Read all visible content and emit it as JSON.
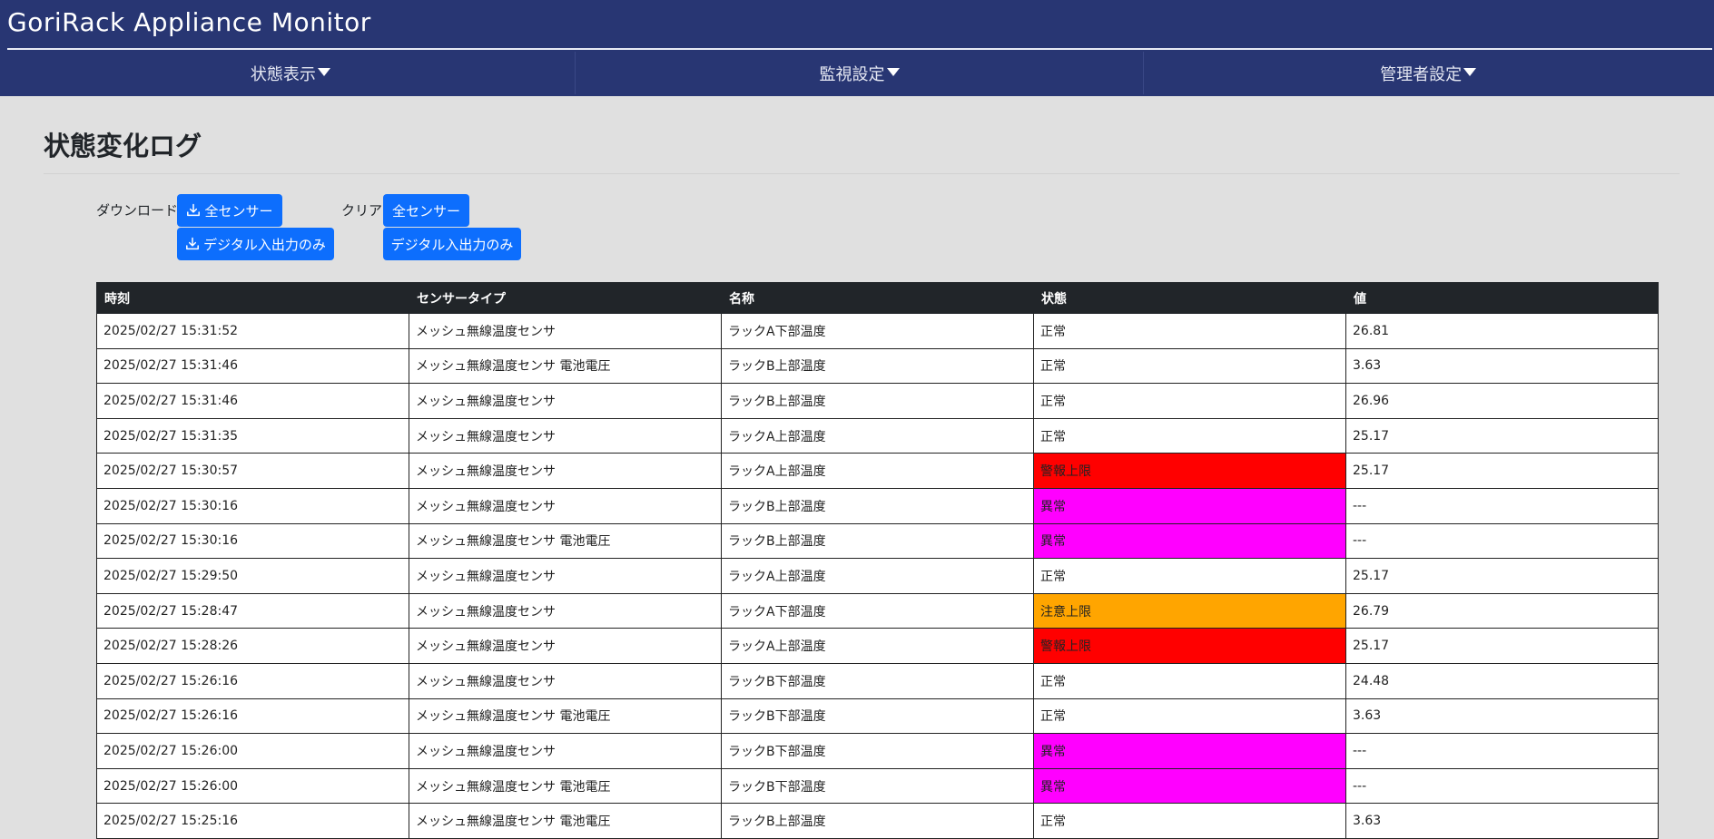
{
  "header": {
    "app_title": "GoriRack Appliance Monitor",
    "nav": [
      {
        "label": "状態表示"
      },
      {
        "label": "監視設定"
      },
      {
        "label": "管理者設定"
      }
    ]
  },
  "page": {
    "title": "状態変化ログ"
  },
  "actions": {
    "download_label": "ダウンロード",
    "clear_label": "クリア",
    "download_all": "全センサー",
    "download_digital": "デジタル入出力のみ",
    "clear_all": "全センサー",
    "clear_digital": "デジタル入出力のみ"
  },
  "table": {
    "columns": [
      "時刻",
      "センサータイプ",
      "名称",
      "状態",
      "値"
    ],
    "rows": [
      {
        "time": "2025/02/27 15:31:52",
        "type": "メッシュ無線温度センサ",
        "name": "ラックA下部温度",
        "status": "正常",
        "value": "26.81",
        "status_class": "normal"
      },
      {
        "time": "2025/02/27 15:31:46",
        "type": "メッシュ無線温度センサ 電池電圧",
        "name": "ラックB上部温度",
        "status": "正常",
        "value": "3.63",
        "status_class": "normal"
      },
      {
        "time": "2025/02/27 15:31:46",
        "type": "メッシュ無線温度センサ",
        "name": "ラックB上部温度",
        "status": "正常",
        "value": "26.96",
        "status_class": "normal"
      },
      {
        "time": "2025/02/27 15:31:35",
        "type": "メッシュ無線温度センサ",
        "name": "ラックA上部温度",
        "status": "正常",
        "value": "25.17",
        "status_class": "normal"
      },
      {
        "time": "2025/02/27 15:30:57",
        "type": "メッシュ無線温度センサ",
        "name": "ラックA上部温度",
        "status": "警報上限",
        "value": "25.17",
        "status_class": "alarm"
      },
      {
        "time": "2025/02/27 15:30:16",
        "type": "メッシュ無線温度センサ",
        "name": "ラックB上部温度",
        "status": "異常",
        "value": "---",
        "status_class": "error"
      },
      {
        "time": "2025/02/27 15:30:16",
        "type": "メッシュ無線温度センサ 電池電圧",
        "name": "ラックB上部温度",
        "status": "異常",
        "value": "---",
        "status_class": "error"
      },
      {
        "time": "2025/02/27 15:29:50",
        "type": "メッシュ無線温度センサ",
        "name": "ラックA上部温度",
        "status": "正常",
        "value": "25.17",
        "status_class": "normal"
      },
      {
        "time": "2025/02/27 15:28:47",
        "type": "メッシュ無線温度センサ",
        "name": "ラックA下部温度",
        "status": "注意上限",
        "value": "26.79",
        "status_class": "warn"
      },
      {
        "time": "2025/02/27 15:28:26",
        "type": "メッシュ無線温度センサ",
        "name": "ラックA上部温度",
        "status": "警報上限",
        "value": "25.17",
        "status_class": "alarm"
      },
      {
        "time": "2025/02/27 15:26:16",
        "type": "メッシュ無線温度センサ",
        "name": "ラックB下部温度",
        "status": "正常",
        "value": "24.48",
        "status_class": "normal"
      },
      {
        "time": "2025/02/27 15:26:16",
        "type": "メッシュ無線温度センサ 電池電圧",
        "name": "ラックB下部温度",
        "status": "正常",
        "value": "3.63",
        "status_class": "normal"
      },
      {
        "time": "2025/02/27 15:26:00",
        "type": "メッシュ無線温度センサ",
        "name": "ラックB下部温度",
        "status": "異常",
        "value": "---",
        "status_class": "error"
      },
      {
        "time": "2025/02/27 15:26:00",
        "type": "メッシュ無線温度センサ 電池電圧",
        "name": "ラックB下部温度",
        "status": "異常",
        "value": "---",
        "status_class": "error"
      },
      {
        "time": "2025/02/27 15:25:16",
        "type": "メッシュ無線温度センサ 電池電圧",
        "name": "ラックB上部温度",
        "status": "正常",
        "value": "3.63",
        "status_class": "normal"
      }
    ]
  },
  "colors": {
    "header_bg": "#283673",
    "button_bg": "#0d6efd",
    "status_alarm": "#ff0000",
    "status_error": "#ff00ff",
    "status_warn": "#ffa500"
  },
  "icons": {
    "download": "download-icon",
    "nav_caret": "caret-down-icon"
  }
}
